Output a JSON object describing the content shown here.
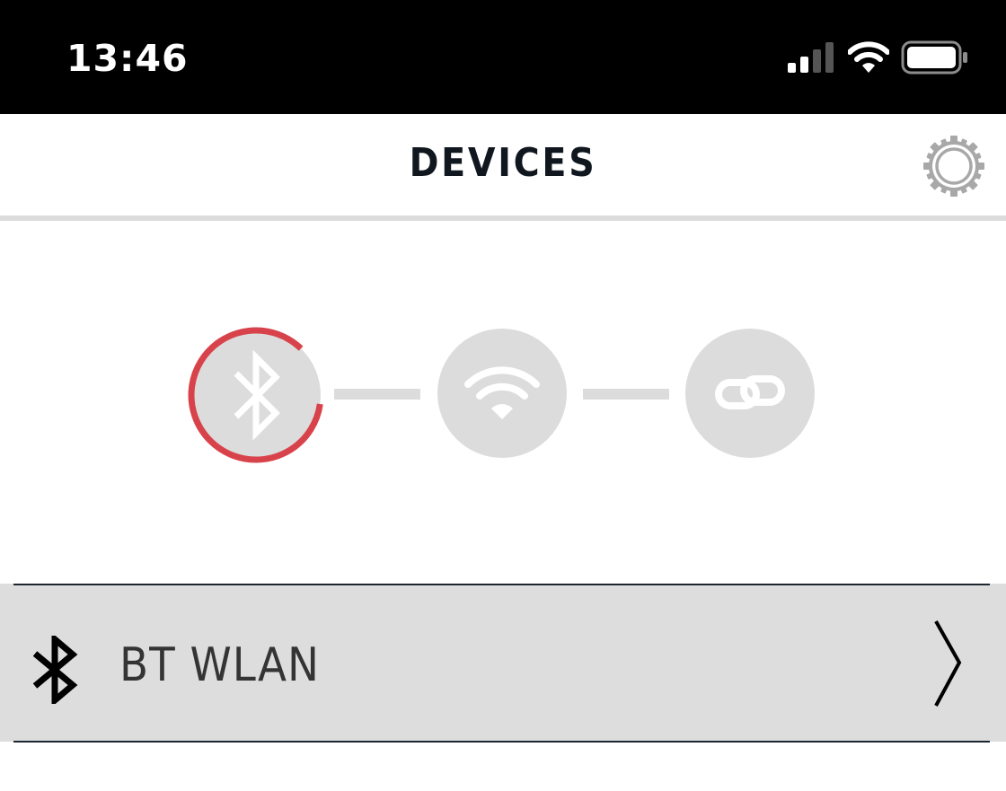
{
  "status_bar": {
    "time": "13:46",
    "icons": [
      "cellular-signal-icon",
      "wifi-icon",
      "battery-icon"
    ]
  },
  "header": {
    "title": "DEVICES",
    "settings_icon": "gear-icon"
  },
  "stepper": {
    "steps": [
      {
        "icon": "bluetooth-icon",
        "state": "active"
      },
      {
        "icon": "wifi-icon",
        "state": "inactive"
      },
      {
        "icon": "link-icon",
        "state": "inactive"
      }
    ],
    "active_progress": 0.85
  },
  "devices": [
    {
      "name": "BT WLAN",
      "icon": "bluetooth-icon",
      "action_icon": "chevron-right-icon"
    }
  ],
  "colors": {
    "status_bar_bg": "#000000",
    "accent_red": "#d8434b",
    "step_gray": "#dcdcdc",
    "title": "#11171e",
    "row_bg": "#dddddd",
    "divider": "#1c2630"
  }
}
